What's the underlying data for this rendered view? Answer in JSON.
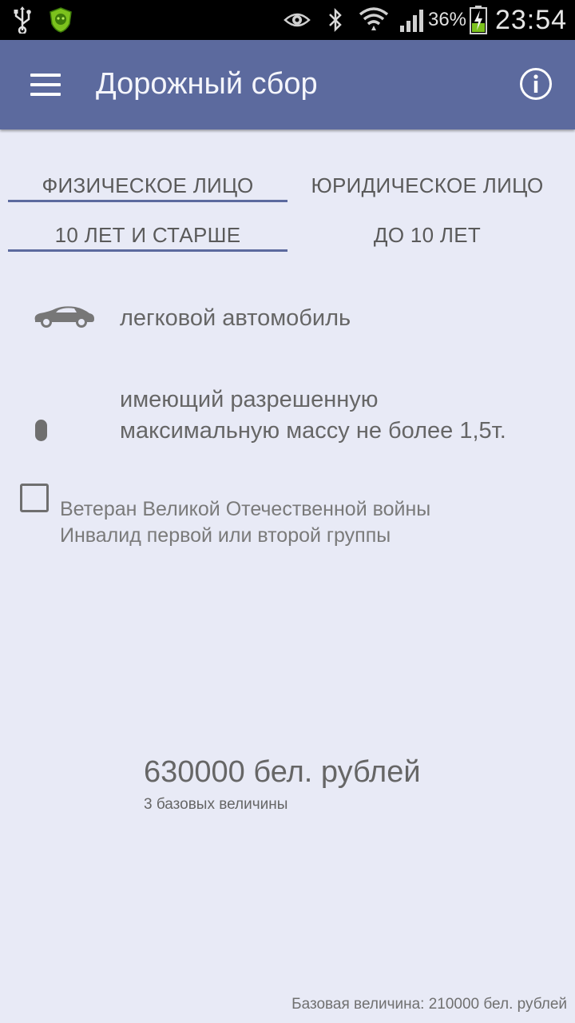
{
  "status_bar": {
    "battery": "36%",
    "time": "23:54",
    "icons": [
      "usb-icon",
      "app-shield-icon",
      "eye-icon",
      "bluetooth-icon",
      "wifi-icon",
      "signal-icon",
      "battery-charging-icon"
    ]
  },
  "app_bar": {
    "title": "Дорожный сбор",
    "menu_icon": "hamburger-menu-icon",
    "info_icon": "info-icon",
    "color": "#5c6a9e"
  },
  "tabs_person": [
    {
      "label": "ФИЗИЧЕСКОЕ ЛИЦО",
      "selected": true
    },
    {
      "label": "ЮРИДИЧЕСКОЕ ЛИЦО",
      "selected": false
    }
  ],
  "tabs_age": [
    {
      "label": "10 ЛЕТ И СТАРШЕ",
      "selected": true
    },
    {
      "label": "ДО 10 ЛЕТ",
      "selected": false
    }
  ],
  "vehicle": {
    "icon": "car-icon",
    "label": "легковой автомобиль"
  },
  "mass": {
    "icon": "weight-indicator-icon",
    "line1": "имеющий разрешенную",
    "line2": "максимальную массу не более 1,5т."
  },
  "benefit": {
    "checked": false,
    "line1": "Ветеран Великой Отечественной войны",
    "line2": "Инвалид первой или второй группы"
  },
  "result": {
    "amount": "630000 бел. рублей",
    "base_count": "3   базовых величины"
  },
  "footer": {
    "base_value": "Базовая величина: 210000 бел. рублей"
  }
}
